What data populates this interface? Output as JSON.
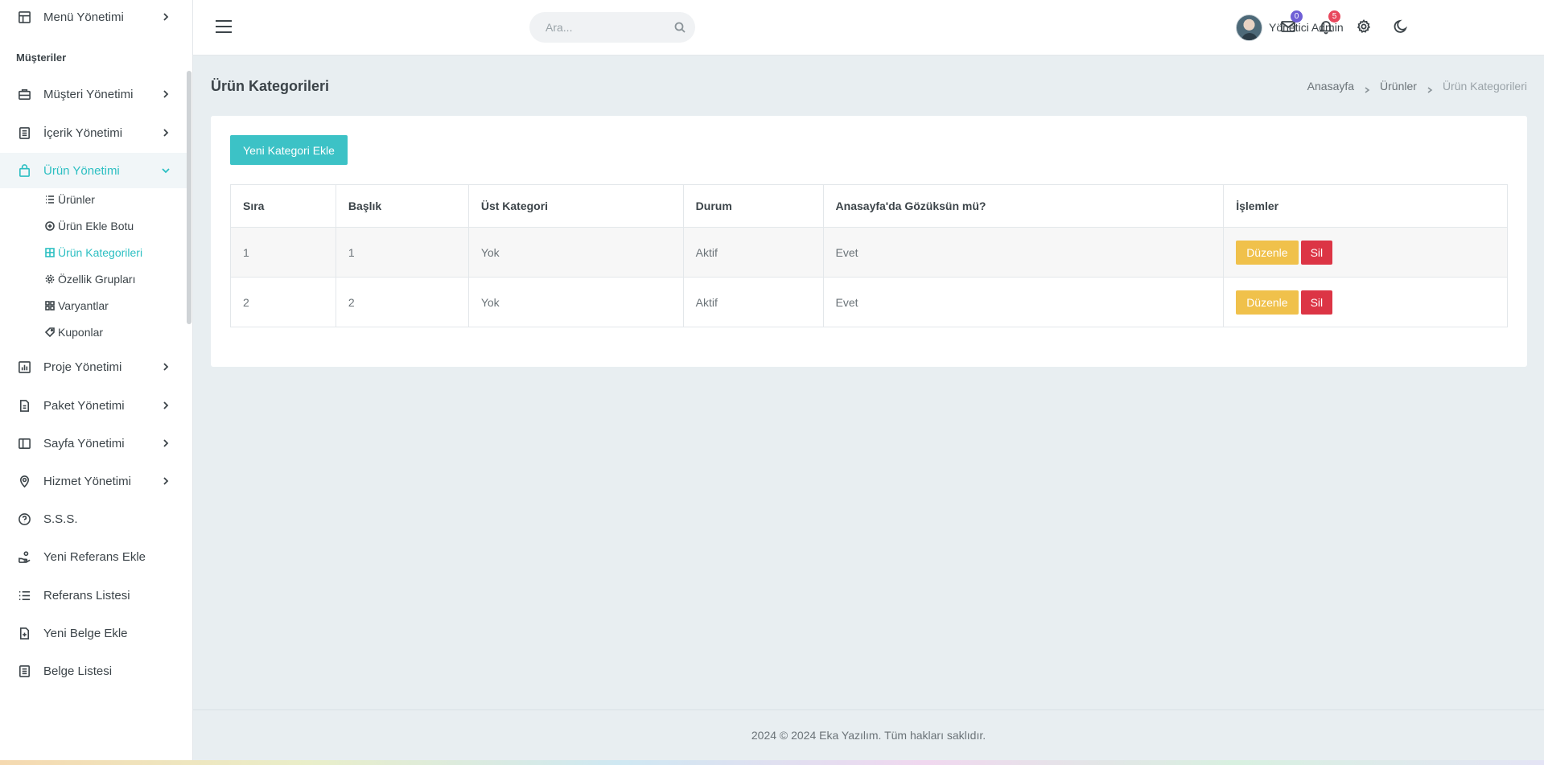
{
  "sidebar": {
    "top_item": "Menü Yönetimi",
    "section_title": "Müşteriler",
    "items": [
      {
        "label": "Müşteri Yönetimi"
      },
      {
        "label": "İçerik Yönetimi"
      },
      {
        "label": "Ürün Yönetimi"
      },
      {
        "label": "Proje Yönetimi"
      },
      {
        "label": "Paket Yönetimi"
      },
      {
        "label": "Sayfa Yönetimi"
      },
      {
        "label": "Hizmet Yönetimi"
      },
      {
        "label": "S.S.S."
      },
      {
        "label": "Yeni Referans Ekle"
      },
      {
        "label": "Referans Listesi"
      },
      {
        "label": "Yeni Belge Ekle"
      },
      {
        "label": "Belge Listesi"
      }
    ],
    "sub_items": [
      {
        "label": "Ürünler"
      },
      {
        "label": "Ürün Ekle Botu"
      },
      {
        "label": "Ürün Kategorileri"
      },
      {
        "label": "Özellik Grupları"
      },
      {
        "label": "Varyantlar"
      },
      {
        "label": "Kuponlar"
      }
    ]
  },
  "header": {
    "search_placeholder": "Ara...",
    "mail_count": "0",
    "notification_count": "5",
    "user_name": "Yönetici Admin"
  },
  "page": {
    "title": "Ürün Kategorileri",
    "breadcrumb": [
      "Anasayfa",
      "Ürünler",
      "Ürün Kategorileri"
    ],
    "add_button": "Yeni Kategori Ekle"
  },
  "table": {
    "headers": [
      "Sıra",
      "Başlık",
      "Üst Kategori",
      "Durum",
      "Anasayfa'da Gözüksün mü?",
      "İşlemler"
    ],
    "rows": [
      {
        "sira": "1",
        "baslik": "1",
        "ust": "Yok",
        "durum": "Aktif",
        "anasayfa": "Evet",
        "edit": "Düzenle",
        "delete": "Sil"
      },
      {
        "sira": "2",
        "baslik": "2",
        "ust": "Yok",
        "durum": "Aktif",
        "anasayfa": "Evet",
        "edit": "Düzenle",
        "delete": "Sil"
      }
    ]
  },
  "footer": {
    "text": "2024 © 2024 Eka Yazılım. Tüm hakları saklıdır."
  },
  "colors": {
    "accent": "#3cc2c6",
    "edit_button": "#f0c14b",
    "delete_button": "#dc3545",
    "mail_badge": "#6f5fd6",
    "notification_badge": "#e8485d"
  }
}
